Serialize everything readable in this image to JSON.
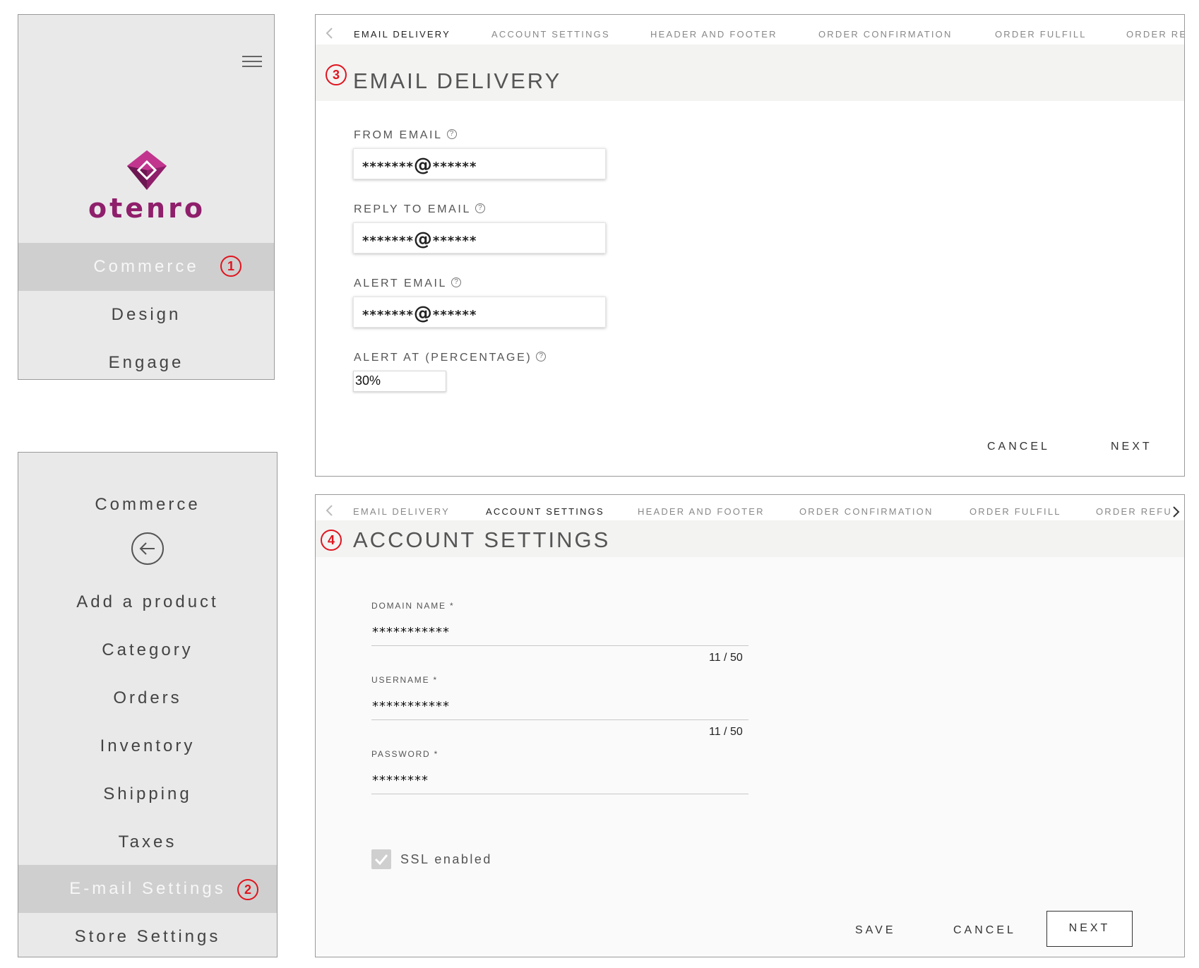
{
  "sidebar1": {
    "logo_text": "otenro",
    "items": [
      "Commerce",
      "Design",
      "Engage"
    ],
    "active_marker": "1"
  },
  "sidebar2": {
    "header": "Commerce",
    "items": [
      "Add a product",
      "Category",
      "Orders",
      "Inventory",
      "Shipping",
      "Taxes",
      "E-mail Settings",
      "Store Settings"
    ],
    "active_marker": "2"
  },
  "email_delivery": {
    "marker": "3",
    "tabs": [
      "EMAIL DELIVERY",
      "ACCOUNT SETTINGS",
      "HEADER AND FOOTER",
      "ORDER CONFIRMATION",
      "ORDER FULFILL",
      "ORDER REI"
    ],
    "title": "EMAIL DELIVERY",
    "fields": [
      {
        "label": "FROM EMAIL",
        "value_pre": "*******",
        "value_at": "@",
        "value_post": "******"
      },
      {
        "label": "REPLY TO EMAIL",
        "value_pre": "*******",
        "value_at": "@",
        "value_post": "******"
      },
      {
        "label": "ALERT EMAIL",
        "value_pre": "*******",
        "value_at": "@",
        "value_post": "******"
      }
    ],
    "alert_at_label": "ALERT AT (PERCENTAGE)",
    "alert_at_value": "30%",
    "help_glyph": "?",
    "cancel": "CANCEL",
    "next": "NEXT"
  },
  "account_settings": {
    "marker": "4",
    "tabs": [
      "EMAIL DELIVERY",
      "ACCOUNT SETTINGS",
      "HEADER AND FOOTER",
      "ORDER CONFIRMATION",
      "ORDER FULFILL",
      "ORDER REFU"
    ],
    "title": "ACCOUNT SETTINGS",
    "domain_label": "DOMAIN NAME *",
    "domain_value": "***********",
    "domain_counter": "11 / 50",
    "username_label": "USERNAME *",
    "username_value": "***********",
    "username_counter": "11 / 50",
    "password_label": "PASSWORD *",
    "password_value": "********",
    "ssl_label": "SSL enabled",
    "ssl_checked": true,
    "save": "SAVE",
    "cancel": "CANCEL",
    "next": "NEXT"
  },
  "colors": {
    "brand": "#8f1f6b",
    "marker": "#e0141e",
    "sidebar_bg": "#e9e9e9",
    "active_item_bg": "#cfcfcf"
  },
  "icons": [
    "hamburger-icon",
    "otenro-logo-icon",
    "back-arrow-icon",
    "chevron-left-icon",
    "chevron-right-icon",
    "help-icon",
    "checkmark-icon"
  ]
}
